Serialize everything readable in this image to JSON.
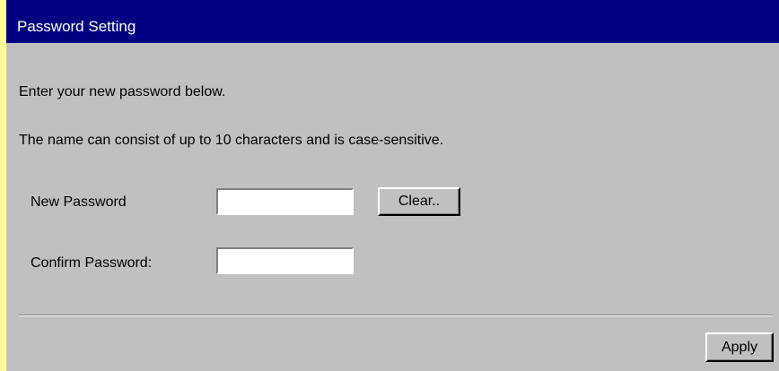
{
  "window": {
    "title": "Password Setting"
  },
  "instructions": {
    "line1": "Enter your new password below.",
    "line2": "The name can consist of up to 10 characters and is case-sensitive."
  },
  "form": {
    "new_password_label": "New Password",
    "new_password_value": "",
    "confirm_password_label": "Confirm Password:",
    "confirm_password_value": "",
    "clear_label": "Clear..",
    "apply_label": "Apply"
  },
  "colors": {
    "title_bar": "#000080",
    "background": "#c0c0c0",
    "left_strip": "#ffff99"
  }
}
